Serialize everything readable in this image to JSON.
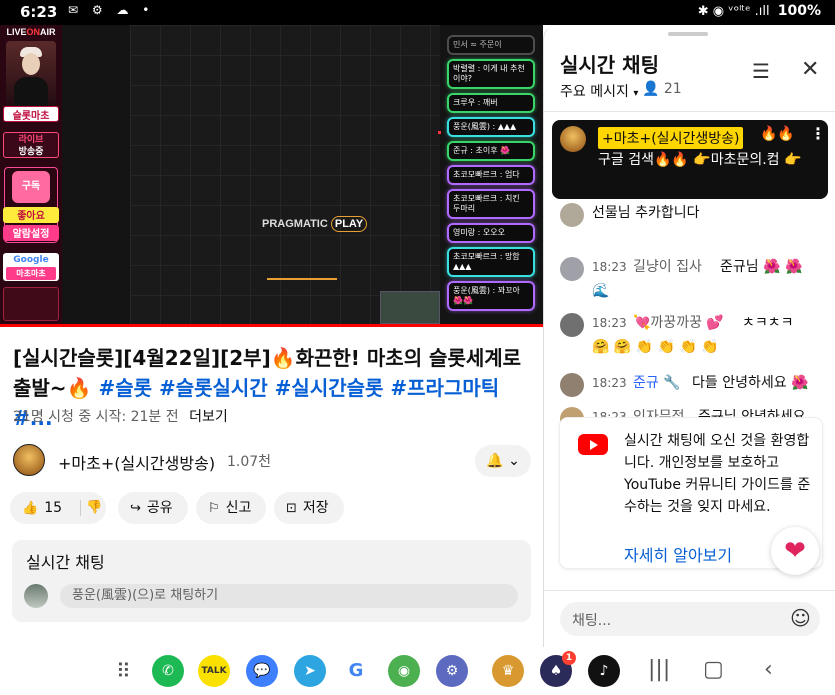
{
  "status_bar": {
    "time": "6:23",
    "left_icons": "✉ ⚙ ☁ •",
    "right_icons": "✱ ◉ ᵛᵒˡᵗᵉ .ıll",
    "battery": "100%"
  },
  "video": {
    "overlay_top_label_white": "LIVE",
    "overlay_top_label_red": "ON",
    "overlay_top_label_white2": "AIR",
    "tag_slot": "슬롯마초",
    "tag_live": "라이브",
    "tag_live2": "방송중",
    "heart_text": "구독",
    "like_text": "좋아요",
    "alarm_text": "알람설정",
    "google_text": "Google",
    "google_sub": "마초마초",
    "provider_logo": "PRAGMATIC",
    "provider_logo_play": "PLAY",
    "overlay_chat": [
      {
        "text": "민서 ≈ 주문이",
        "style": "dim"
      },
      {
        "text": "박렬렬 : 이게 내 추천이야?",
        "style": "green"
      },
      {
        "text": "크루우 : 깨버",
        "style": "green"
      },
      {
        "text": "풍운(風雲) : ▲▲▲",
        "style": "cyan"
      },
      {
        "text": "준규 : 초이후 🌺",
        "style": "green"
      },
      {
        "text": "초코모빠르크 : 엄다",
        "style": "purple"
      },
      {
        "text": "초코모빠르크 : 치킨 두마리",
        "style": "purple"
      },
      {
        "text": "영미랑 : 오오오",
        "style": "purple"
      },
      {
        "text": "초코모빠르크 : 망함 ▲▲▲",
        "style": "cyan"
      },
      {
        "text": "풍운(風雲) : 꽈꼬아 🌺🌺",
        "style": "purple"
      }
    ]
  },
  "title": {
    "main": "[실시간슬롯][4월22일][2부]🔥화끈한! 마초의 슬롯세계로 출발~🔥 ",
    "tags": "#슬롯 #슬롯실시간 #실시간슬롯 #프라그마틱 #..."
  },
  "meta": {
    "viewers_started": "21명 시청 중  시작: 21분 전",
    "more": "더보기"
  },
  "channel": {
    "name": "+마초+(실시간생방송)",
    "subscribers": "1.07천",
    "bell_label": "🔔 ⌄"
  },
  "actions": {
    "like_count": "15",
    "share": "공유",
    "report": "신고",
    "save": "저장"
  },
  "chat_peek": {
    "title": "실시간 채팅",
    "placeholder": "풍운(風雲)(으)로 채팅하기"
  },
  "live_chat": {
    "title": "실시간 채팅",
    "filter": "주요 메시지",
    "viewers": "👤 21",
    "pinned": {
      "author": "+마초+(실시간생방송)",
      "fire": "🔥🔥",
      "message": "구글 검색🔥🔥 👉마초문의.컴 👉"
    },
    "messages": [
      {
        "time": "",
        "author": "",
        "text": "선물님 추카합니다",
        "avatar_color": "#b0a898"
      },
      {
        "time": "18:23",
        "author": "길냥이 집사",
        "text": "준규님 🌺 🌺",
        "cont": "🌊",
        "avatar_color": "#a0a0a8"
      },
      {
        "time": "18:23",
        "author": "💘까꿍까꿍 💕",
        "text": "ㅊㅋㅊㅋ",
        "cont": "🤗 🤗 👏 👏 👏 👏",
        "avatar_color": "#707070"
      },
      {
        "time": "18:23",
        "author": "준규 🔧",
        "text": "다들 안녕하세요 🌺",
        "mod": true,
        "avatar_color": "#908070"
      },
      {
        "time": "18:23",
        "author": "인자무적",
        "text": "준규님 안녕하세요",
        "avatar_color": "#c0a070"
      }
    ],
    "notice_text": "실시간 채팅에 오신 것을 환영합니다. 개인정보를 보호하고 YouTube 커뮤니티 가이드를 준수하는 것을 잊지 마세요.",
    "notice_link": "자세히 알아보기",
    "input_placeholder": "채팅..."
  },
  "nav": {
    "apps": [
      {
        "name": "phone",
        "label": "✆",
        "color": "#1db954"
      },
      {
        "name": "kakaotalk",
        "label": "TALK",
        "color": "#fae100"
      },
      {
        "name": "messages",
        "label": "💬",
        "color": "#3d7fff"
      },
      {
        "name": "telegram",
        "label": "➤",
        "color": "#2ca5e0"
      },
      {
        "name": "google",
        "label": "G",
        "color": "#ffffff"
      },
      {
        "name": "chrome",
        "label": "◉",
        "color": "#4caf50"
      },
      {
        "name": "settings",
        "label": "⚙",
        "color": "#5c6bc0"
      },
      {
        "name": "slot-app",
        "label": "♛",
        "color": "#d89a30"
      },
      {
        "name": "poker-app",
        "label": "♠",
        "color": "#2b2b5a",
        "badge": "1"
      },
      {
        "name": "tiktok",
        "label": "♪",
        "color": "#111111"
      }
    ]
  }
}
